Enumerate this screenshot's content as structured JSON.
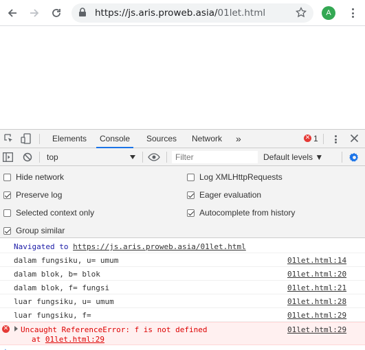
{
  "browser": {
    "url_host": "https://js.aris.proweb.asia/",
    "url_path": "01let.html",
    "profile_initial": "A",
    "icons": [
      "back-icon",
      "forward-icon",
      "reload-icon",
      "lock-icon",
      "star-icon",
      "menu-icon"
    ]
  },
  "devtools": {
    "tabs": [
      "Elements",
      "Console",
      "Sources",
      "Network"
    ],
    "active_tab": "Console",
    "more_tabs_label": "»",
    "error_count": "1",
    "toolbar": {
      "context": "top",
      "filter_placeholder": "Filter",
      "levels_label": "Default levels ▼"
    },
    "settings": {
      "hide_network": {
        "label": "Hide network",
        "checked": false
      },
      "preserve_log": {
        "label": "Preserve log",
        "checked": true
      },
      "selected_context_only": {
        "label": "Selected context only",
        "checked": false
      },
      "group_similar": {
        "label": "Group similar",
        "checked": true
      },
      "log_xmlhttp": {
        "label": "Log XMLHttpRequests",
        "checked": false
      },
      "eager_eval": {
        "label": "Eager evaluation",
        "checked": true
      },
      "autocomplete": {
        "label": "Autocomplete from history",
        "checked": true
      }
    },
    "console": {
      "navigated_prefix": "Navigated to ",
      "navigated_url": "https://js.aris.proweb.asia/01let.html",
      "logs": [
        {
          "msg": "dalam fungsiku, u= umum",
          "src": "01let.html:14"
        },
        {
          "msg": "dalam blok, b= blok",
          "src": "01let.html:20"
        },
        {
          "msg": "dalam blok, f= fungsi",
          "src": "01let.html:21"
        },
        {
          "msg": "luar fungsiku, u= umum",
          "src": "01let.html:28"
        },
        {
          "msg": "luar fungsiku, f=",
          "src": "01let.html:29"
        }
      ],
      "error": {
        "msg": "Uncaught ReferenceError: f is not defined",
        "at_prefix": "at ",
        "at_link": "01let.html:29",
        "src": "01let.html:29"
      },
      "prompt": "›"
    }
  }
}
